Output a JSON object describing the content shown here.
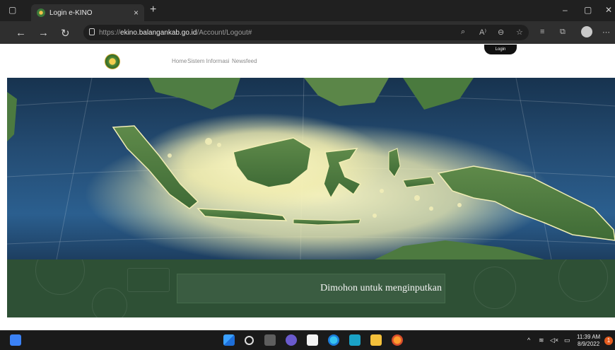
{
  "browser": {
    "tab_title": "Login e-KINO",
    "tab_close": "×",
    "new_tab": "+",
    "url_prefix": "https://",
    "url_host": "ekino.balangankab.go.id",
    "url_path": "/Account/Logout#",
    "window_controls": {
      "minimize": "–",
      "maximize": "▢",
      "close": "✕"
    },
    "nav": {
      "back": "←",
      "forward": "→",
      "refresh": "↻"
    },
    "toolbar_icons": [
      "read-aloud-icon",
      "text-size-icon",
      "zoom-icon",
      "favorites-icon",
      "collections-icon",
      "profile-icon",
      "more-icon"
    ],
    "more": "⋯"
  },
  "site": {
    "nav": {
      "home": "Home",
      "sistem_informasi": "Sistem Informasi",
      "newsfeed": "Newsfeed"
    },
    "login_label": "Login",
    "banner_text": "Dimohon untuk menginputkan"
  },
  "taskbar": {
    "tray_chevron": "^",
    "time": "11:39 AM",
    "date": "8/9/2022",
    "notification_count": "1"
  },
  "colors": {
    "banner_green": "#2e5035",
    "login_button": "#111111",
    "ocean": "#244c73"
  }
}
